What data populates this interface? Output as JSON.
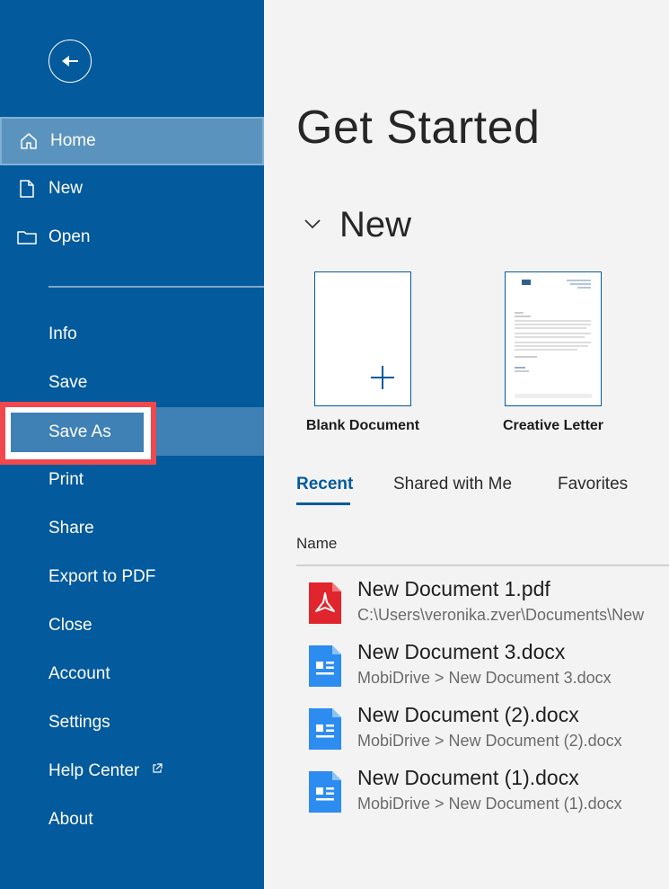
{
  "sidebar": {
    "back_label": "Back",
    "items": [
      {
        "label": "Home"
      },
      {
        "label": "New"
      },
      {
        "label": "Open"
      },
      {
        "label": "Info"
      },
      {
        "label": "Save"
      },
      {
        "label": "Save As"
      },
      {
        "label": "Print"
      },
      {
        "label": "Share"
      },
      {
        "label": "Export to PDF"
      },
      {
        "label": "Close"
      },
      {
        "label": "Account"
      },
      {
        "label": "Settings"
      },
      {
        "label": "Help Center"
      },
      {
        "label": "About"
      }
    ]
  },
  "main": {
    "title": "Get Started",
    "new_section": {
      "title": "New",
      "templates": [
        {
          "label": "Blank Document"
        },
        {
          "label": "Creative Letter"
        }
      ]
    },
    "tabs": [
      {
        "label": "Recent"
      },
      {
        "label": "Shared with Me"
      },
      {
        "label": "Favorites"
      }
    ],
    "column_header": "Name",
    "files": [
      {
        "name": "New Document 1.pdf",
        "path": "C:\\Users\\veronika.zver\\Documents\\New",
        "type": "pdf"
      },
      {
        "name": "New Document 3.docx",
        "path": "MobiDrive > New Document 3.docx",
        "type": "docx"
      },
      {
        "name": "New Document (2).docx",
        "path": "MobiDrive > New Document (2).docx",
        "type": "docx"
      },
      {
        "name": "New Document (1).docx",
        "path": "MobiDrive > New Document (1).docx",
        "type": "docx"
      }
    ]
  },
  "colors": {
    "sidebar_bg": "#035a9c",
    "accent": "#035a9c",
    "highlight_border": "#f0484d",
    "pdf_red": "#e0252c",
    "docx_blue": "#2d8cf0"
  }
}
